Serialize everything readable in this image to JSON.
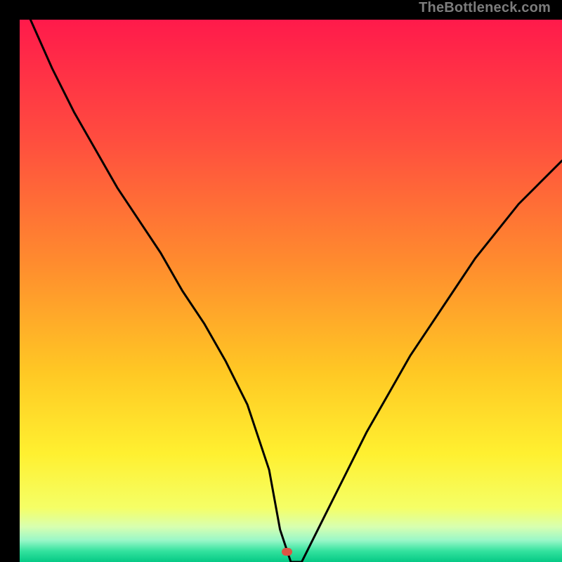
{
  "watermark": "TheBottleneck.com",
  "chart_data": {
    "type": "line",
    "title": "",
    "xlabel": "",
    "ylabel": "",
    "xlim": [
      0,
      100
    ],
    "ylim": [
      0,
      100
    ],
    "grid": false,
    "legend": false,
    "series": [
      {
        "name": "curve",
        "x": [
          2,
          6,
          10,
          14,
          18,
          22,
          26,
          30,
          34,
          38,
          42,
          46,
          48,
          50,
          52,
          56,
          60,
          64,
          68,
          72,
          76,
          80,
          84,
          88,
          92,
          96,
          100
        ],
        "y": [
          100,
          91,
          83,
          76,
          69,
          63,
          57,
          50,
          44,
          37,
          29,
          17,
          6,
          0,
          0,
          8,
          16,
          24,
          31,
          38,
          44,
          50,
          56,
          61,
          66,
          70,
          74
        ]
      }
    ],
    "marker": {
      "x": 51,
      "y": 0,
      "color": "#dd5544"
    },
    "gradient_stops": [
      {
        "offset": 0.0,
        "color": "#ff1a4b"
      },
      {
        "offset": 0.22,
        "color": "#ff4d3f"
      },
      {
        "offset": 0.45,
        "color": "#ff8c2e"
      },
      {
        "offset": 0.65,
        "color": "#ffc824"
      },
      {
        "offset": 0.8,
        "color": "#fff030"
      },
      {
        "offset": 0.9,
        "color": "#f5ff66"
      },
      {
        "offset": 0.935,
        "color": "#d8ffb0"
      },
      {
        "offset": 0.96,
        "color": "#99f7c8"
      },
      {
        "offset": 0.98,
        "color": "#33e29e"
      },
      {
        "offset": 1.0,
        "color": "#05c985"
      }
    ]
  }
}
